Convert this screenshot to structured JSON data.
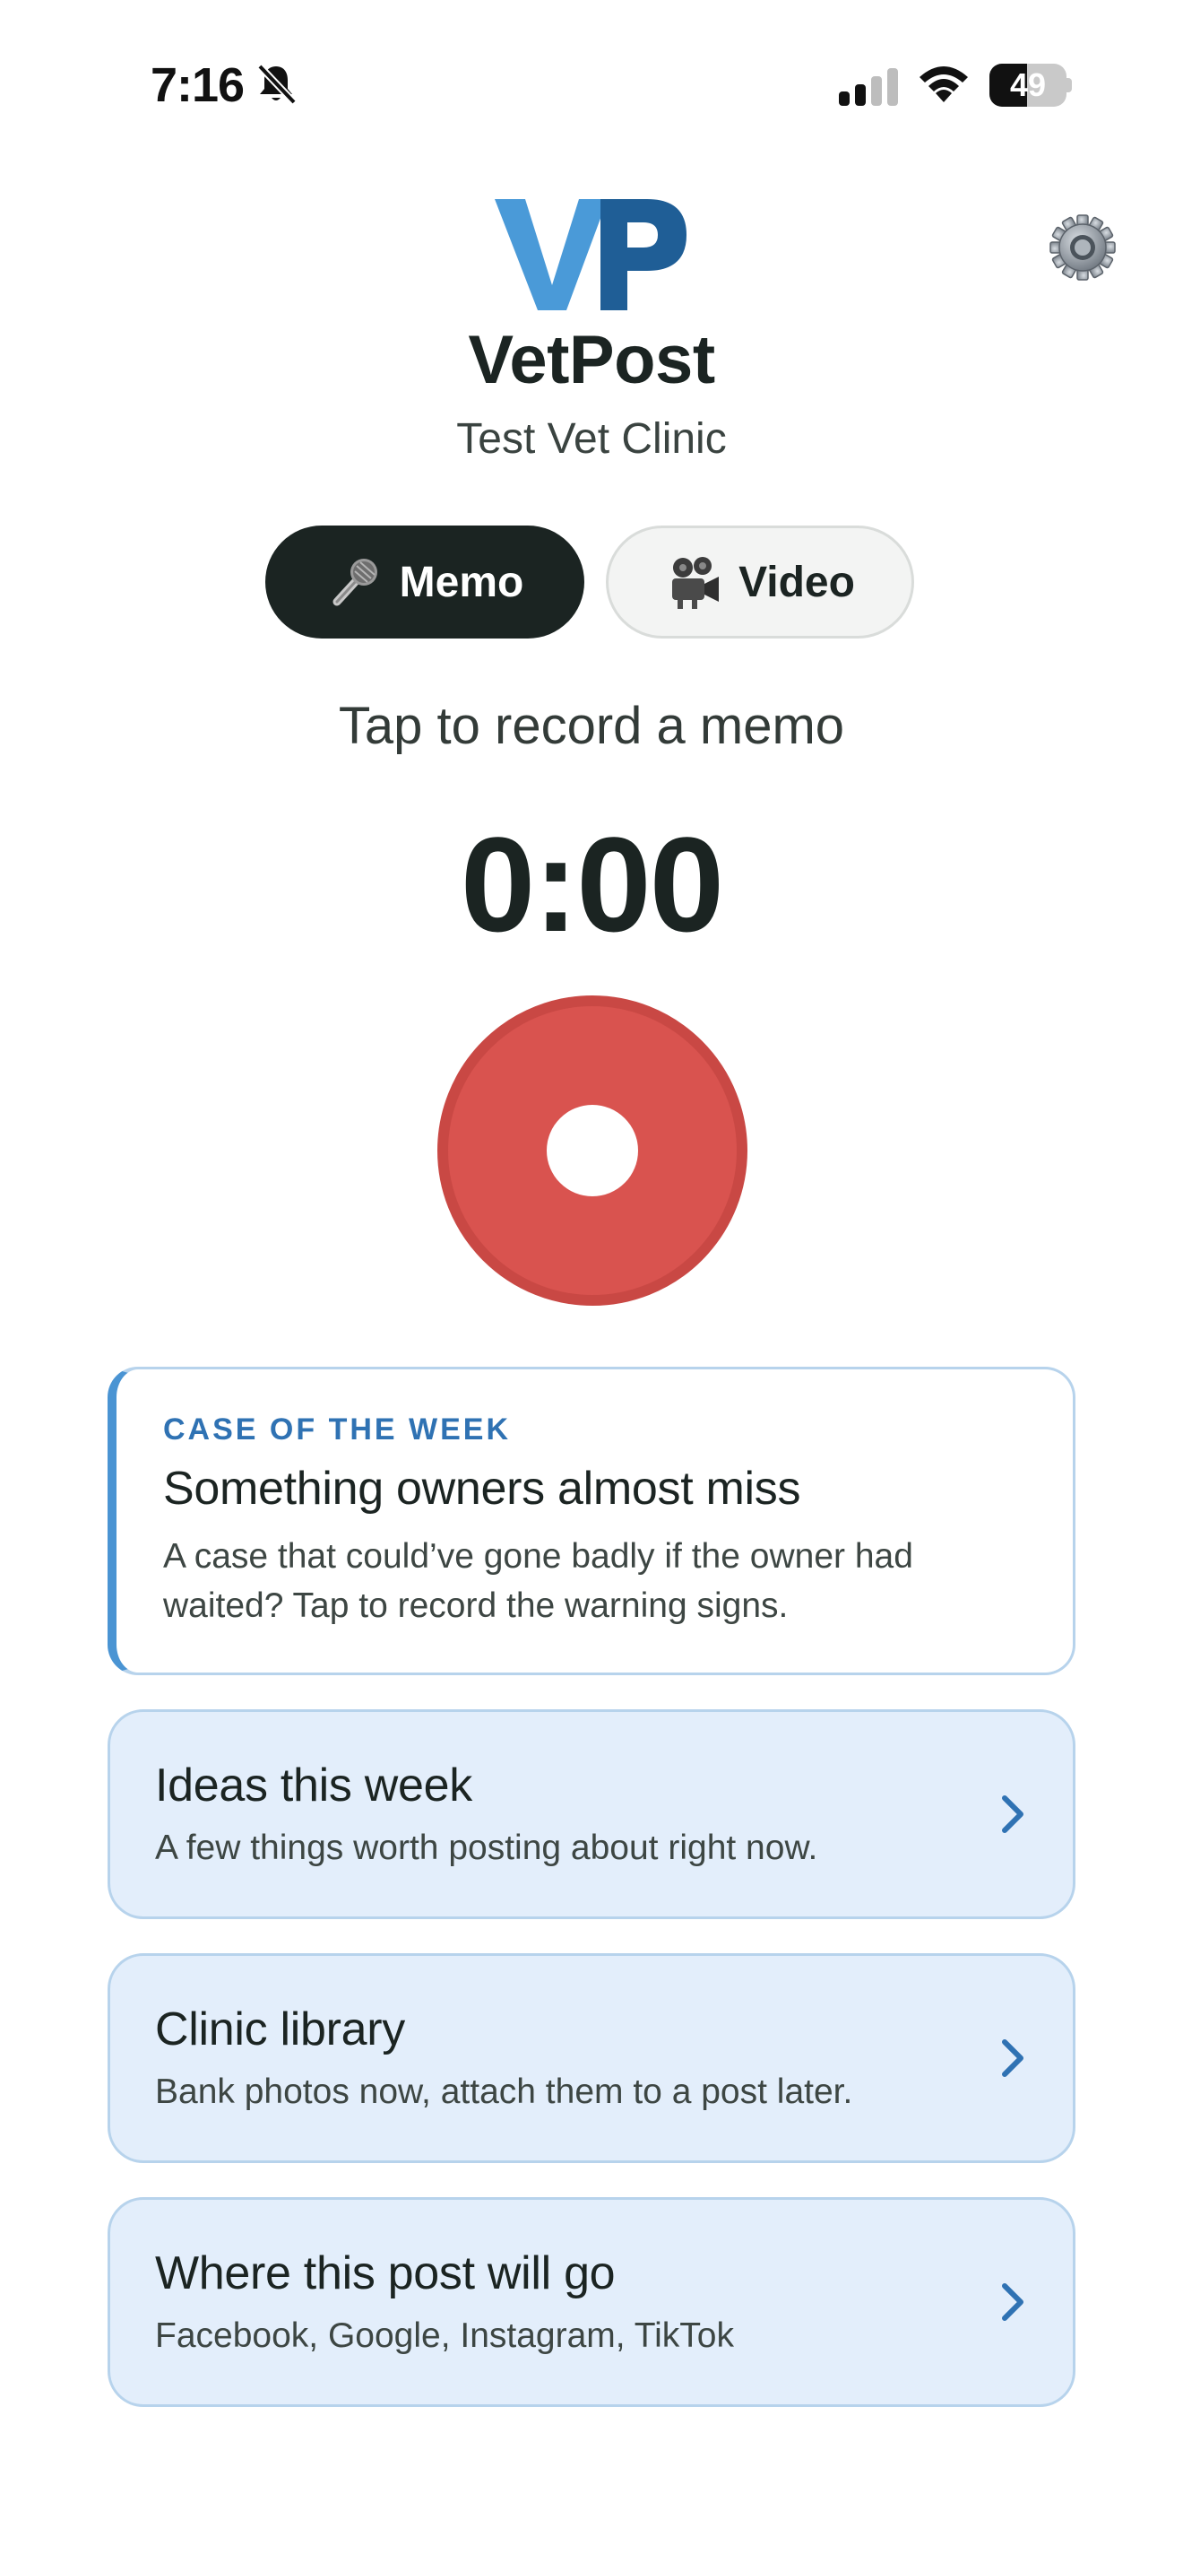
{
  "status_bar": {
    "time": "7:16",
    "battery": "49",
    "battery_level": 0.49
  },
  "header": {
    "logo_text": "VP",
    "logo_colors": {
      "v": "#4a9ad8",
      "p": "#1f5e96"
    },
    "app_title": "VetPost",
    "clinic_name": "Test Vet Clinic",
    "settings_icon": "gear-icon"
  },
  "mode_toggle": {
    "memo_label": "Memo",
    "memo_icon": "microphone-icon",
    "video_label": "Video",
    "video_icon": "movie-camera-icon",
    "selected": "memo"
  },
  "recorder": {
    "hint": "Tap to record a memo",
    "timer": "0:00",
    "button_color": "#d9534f"
  },
  "case_of_week": {
    "eyebrow": "CASE OF THE WEEK",
    "title": "Something owners almost miss",
    "description": "A case that could’ve gone badly if the owner had waited? Tap to record the warning signs.",
    "accent": "#4a94d3"
  },
  "nav_cards": [
    {
      "title": "Ideas this week",
      "subtitle": "A few things worth posting about right now."
    },
    {
      "title": "Clinic library",
      "subtitle": "Bank photos now, attach them to a post later."
    },
    {
      "title": "Where this post will go",
      "subtitle": "Facebook, Google, Instagram, TikTok"
    }
  ]
}
